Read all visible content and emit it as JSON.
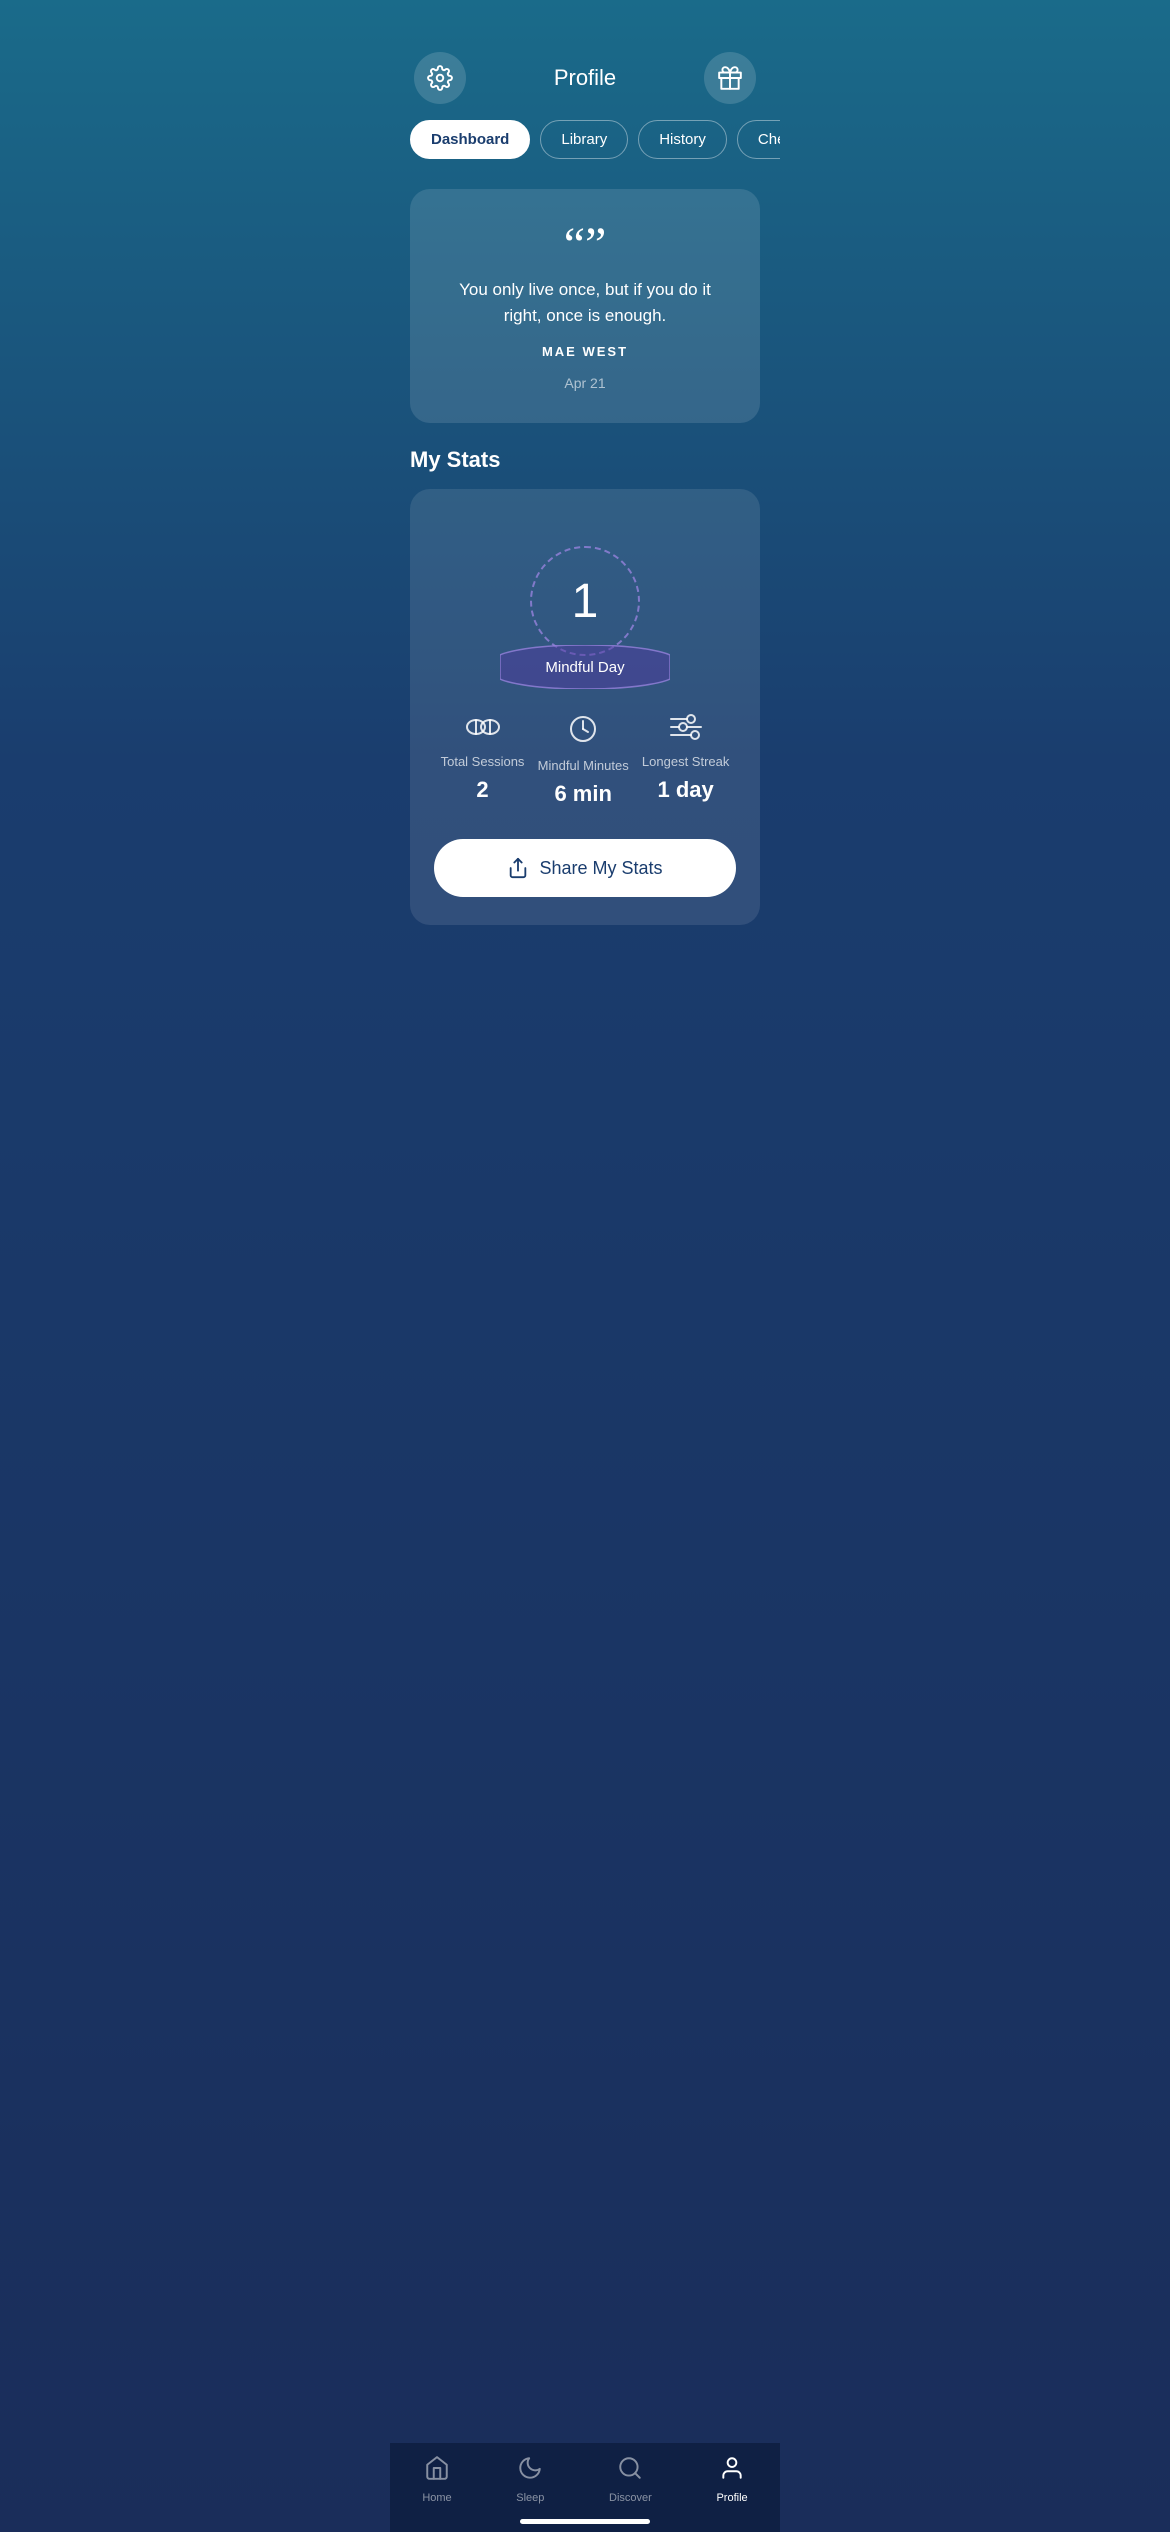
{
  "header": {
    "title": "Profile",
    "gear_icon": "gear",
    "gift_icon": "gift"
  },
  "tabs": [
    {
      "label": "Dashboard",
      "active": true
    },
    {
      "label": "Library",
      "active": false
    },
    {
      "label": "History",
      "active": false
    },
    {
      "label": "Check-Ins",
      "active": false
    }
  ],
  "quote": {
    "mark": "“”",
    "text": "You only live once, but if you do it right, once is enough.",
    "author": "MAE WEST",
    "date": "Apr 21"
  },
  "my_stats": {
    "section_label": "My Stats",
    "badge_number": "1",
    "badge_label": "Mindful Day",
    "stats": [
      {
        "label": "Total Sessions",
        "value": "2"
      },
      {
        "label": "Mindful Minutes",
        "value": "6 min"
      },
      {
        "label": "Longest Streak",
        "value": "1 day"
      }
    ],
    "share_button": "Share My Stats"
  },
  "bottom_nav": [
    {
      "label": "Home",
      "active": false
    },
    {
      "label": "Sleep",
      "active": false
    },
    {
      "label": "Discover",
      "active": false
    },
    {
      "label": "Profile",
      "active": true
    }
  ]
}
